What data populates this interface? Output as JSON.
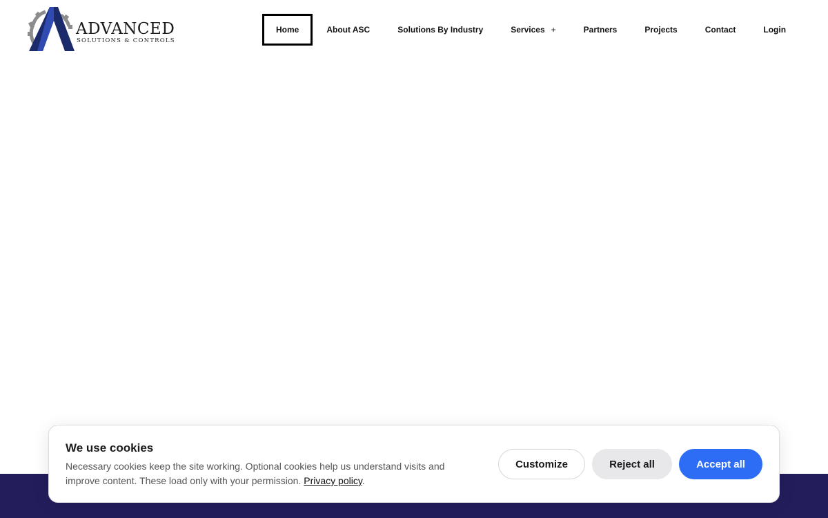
{
  "brand": {
    "wordmark": "ADVANCED",
    "tagline": "SOLUTIONS & CONTROLS"
  },
  "nav": {
    "items": [
      {
        "label": "Home"
      },
      {
        "label": "About ASC"
      },
      {
        "label": "Solutions By Industry"
      },
      {
        "label": "Services",
        "suffix": "+"
      },
      {
        "label": "Partners"
      },
      {
        "label": "Projects"
      },
      {
        "label": "Contact"
      },
      {
        "label": "Login"
      }
    ]
  },
  "cookie_banner": {
    "title": "We use cookies",
    "text": "Necessary cookies keep the site working. Optional cookies help us understand visits and improve content. These load only with your permission.",
    "privacy_link": "Privacy policy",
    "after_link": ".",
    "customize_label": "Customize",
    "reject_label": "Reject all",
    "accept_label": "Accept all"
  },
  "colors": {
    "accent": "#2d6df6",
    "footer": "#231d5c",
    "logo_navy": "#1b2a6b"
  }
}
